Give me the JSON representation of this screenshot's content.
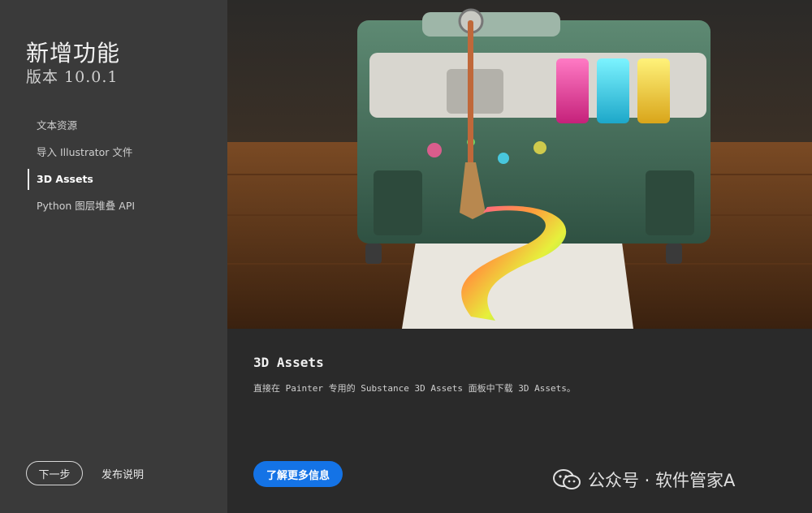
{
  "sidebar": {
    "title": "新增功能",
    "version": "版本 10.0.1",
    "items": [
      {
        "label": "文本资源"
      },
      {
        "label": "导入 Illustrator 文件"
      },
      {
        "label": "3D Assets"
      },
      {
        "label": "Python 图层堆叠 API"
      }
    ],
    "active_index": 2,
    "next_label": "下一步",
    "release_notes_label": "发布说明"
  },
  "content": {
    "heading": "3D Assets",
    "description": "直接在 Painter 专用的 Substance 3D Assets 面板中下载 3D Assets。",
    "learn_more_label": "了解更多信息"
  },
  "watermark": {
    "text": "公众号 · 软件管家A",
    "icon": "wechat-icon"
  },
  "colors": {
    "sidebar_bg": "#3a3a3a",
    "main_bg": "#2a2a2a",
    "accent": "#1473e6"
  }
}
